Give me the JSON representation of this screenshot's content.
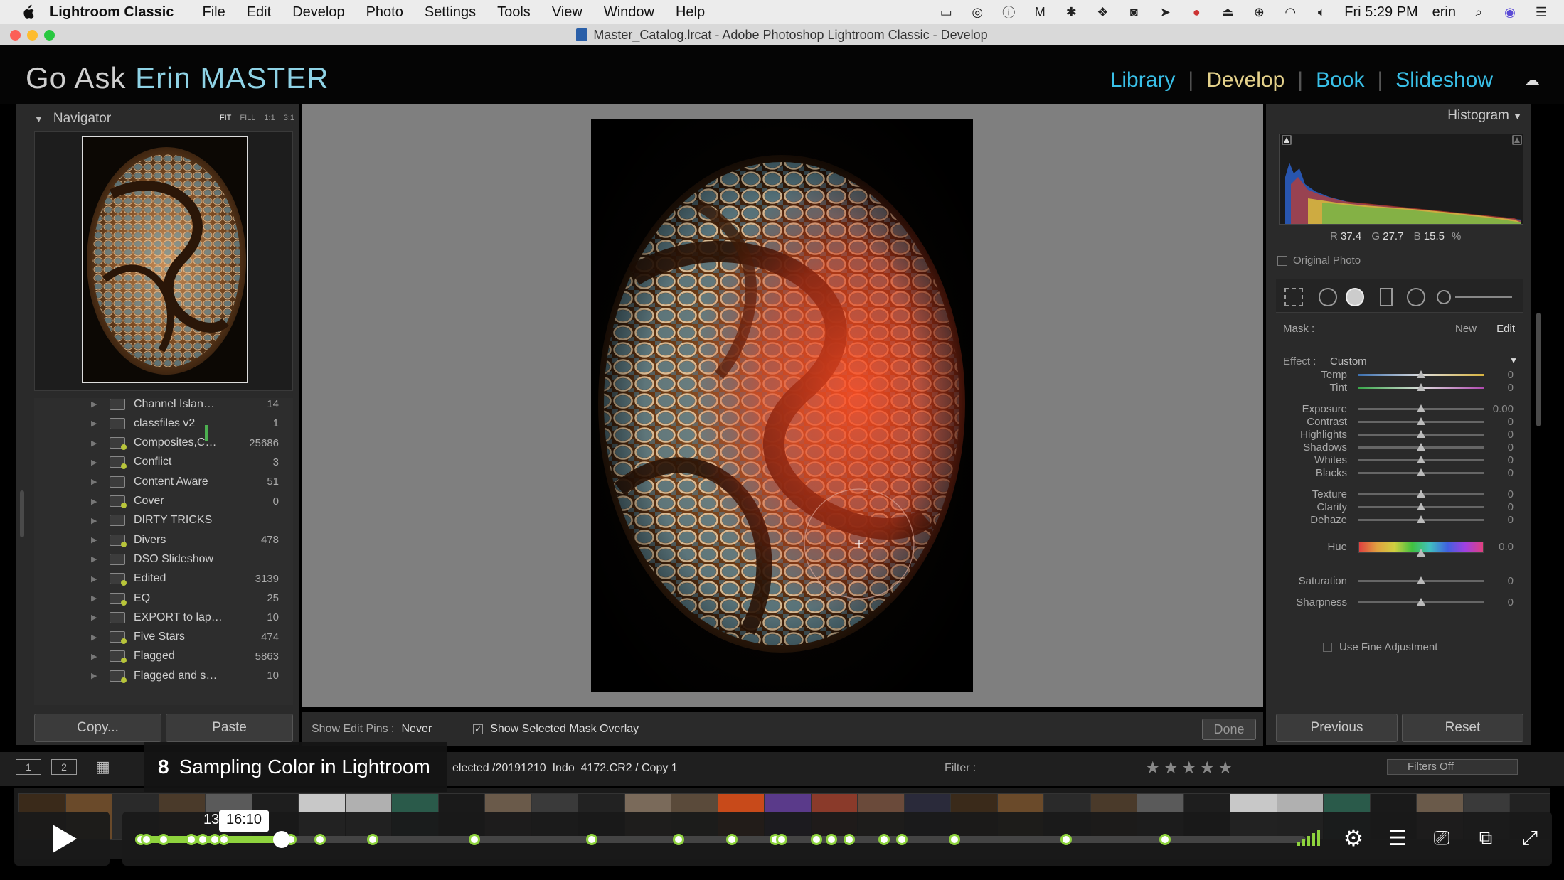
{
  "menubar": {
    "app": "Lightroom Classic",
    "items": [
      "File",
      "Edit",
      "Develop",
      "Photo",
      "Settings",
      "Tools",
      "View",
      "Window",
      "Help"
    ],
    "clock": "Fri 5:29 PM",
    "user": "erin"
  },
  "window": {
    "title": "Master_Catalog.lrcat - Adobe Photoshop Lightroom Classic - Develop"
  },
  "identity": {
    "prefix": "Go Ask",
    "accent": "Erin MASTER"
  },
  "modules": {
    "items": [
      "Library",
      "Develop",
      "Book",
      "Slideshow"
    ],
    "active": "Develop",
    "active_color": "#e3d08a",
    "inactive_color": "#39c0e8"
  },
  "navigator": {
    "title": "Navigator",
    "zoom": [
      "FIT",
      "FILL",
      "1:1",
      "3:1"
    ]
  },
  "collections": [
    {
      "name": "Channel Islan…",
      "count": "14",
      "smart": false
    },
    {
      "name": "classfiles v2",
      "count": "1",
      "smart": false
    },
    {
      "name": "Composites,C…",
      "count": "25686",
      "smart": true
    },
    {
      "name": "Conflict",
      "count": "3",
      "smart": true
    },
    {
      "name": "Content Aware",
      "count": "51",
      "smart": false
    },
    {
      "name": "Cover",
      "count": "0",
      "smart": true
    },
    {
      "name": "DIRTY TRICKS",
      "count": "",
      "smart": false
    },
    {
      "name": "Divers",
      "count": "478",
      "smart": true
    },
    {
      "name": "DSO Slideshow",
      "count": "",
      "smart": false
    },
    {
      "name": "Edited",
      "count": "3139",
      "smart": true
    },
    {
      "name": "EQ",
      "count": "25",
      "smart": true
    },
    {
      "name": "EXPORT to lap…",
      "count": "10",
      "smart": false
    },
    {
      "name": "Five Stars",
      "count": "474",
      "smart": true
    },
    {
      "name": "Flagged",
      "count": "5863",
      "smart": true
    },
    {
      "name": "Flagged and s…",
      "count": "10",
      "smart": true
    }
  ],
  "left_buttons": {
    "copy": "Copy...",
    "paste": "Paste"
  },
  "toolbar": {
    "pins_label": "Show Edit Pins :",
    "pins_value": "Never",
    "overlay_check": "✓",
    "overlay_label": "Show Selected Mask Overlay",
    "done": "Done"
  },
  "histogram": {
    "title": "Histogram",
    "r_label": "R",
    "r": "37.4",
    "g_label": "G",
    "g": "27.7",
    "b_label": "B",
    "b": "15.5",
    "unit": "%",
    "original_photo": "Original Photo"
  },
  "mask": {
    "label": "Mask :",
    "new": "New",
    "edit": "Edit",
    "effect_label": "Effect :",
    "effect_value": "Custom"
  },
  "sliders": [
    {
      "label": "Temp",
      "value": "0",
      "pos": 0.5,
      "style": "temp"
    },
    {
      "label": "Tint",
      "value": "0",
      "pos": 0.5,
      "style": "tint"
    },
    {
      "label": "Exposure",
      "value": "0.00",
      "pos": 0.5,
      "style": ""
    },
    {
      "label": "Contrast",
      "value": "0",
      "pos": 0.5,
      "style": ""
    },
    {
      "label": "Highlights",
      "value": "0",
      "pos": 0.5,
      "style": ""
    },
    {
      "label": "Shadows",
      "value": "0",
      "pos": 0.5,
      "style": ""
    },
    {
      "label": "Whites",
      "value": "0",
      "pos": 0.5,
      "style": ""
    },
    {
      "label": "Blacks",
      "value": "0",
      "pos": 0.5,
      "style": ""
    },
    {
      "label": "Texture",
      "value": "0",
      "pos": 0.5,
      "style": ""
    },
    {
      "label": "Clarity",
      "value": "0",
      "pos": 0.5,
      "style": ""
    },
    {
      "label": "Dehaze",
      "value": "0",
      "pos": 0.5,
      "style": ""
    },
    {
      "label": "Hue",
      "value": "0.0",
      "pos": 0.5,
      "style": "hue"
    },
    {
      "label": "Saturation",
      "value": "0",
      "pos": 0.5,
      "style": ""
    },
    {
      "label": "Sharpness",
      "value": "0",
      "pos": 0.5,
      "style": ""
    }
  ],
  "fine_adjust": "Use Fine Adjustment",
  "right_buttons": {
    "previous": "Previous",
    "reset": "Reset"
  },
  "filmstrip_bar": {
    "view1": "1",
    "view2": "2",
    "crumb": "elected /20191210_Indo_4172.CR2 / Copy 1",
    "filter_label": "Filter :",
    "filters_off": "Filters Off"
  },
  "video": {
    "chapter_num": "8",
    "chapter_title": "Sampling Color in Lightroom",
    "current_time": "13:",
    "hover_time": "16:10",
    "played_fraction": 0.125,
    "loaded_fraction": 0.12,
    "chapter_markers": [
      0.005,
      0.01,
      0.024,
      0.048,
      0.058,
      0.068,
      0.076,
      0.133,
      0.158,
      0.203,
      0.29,
      0.39,
      0.464,
      0.51,
      0.547,
      0.552,
      0.582,
      0.595,
      0.61,
      0.64,
      0.655,
      0.7,
      0.795,
      0.88
    ],
    "accent_color": "#8ed33d"
  }
}
